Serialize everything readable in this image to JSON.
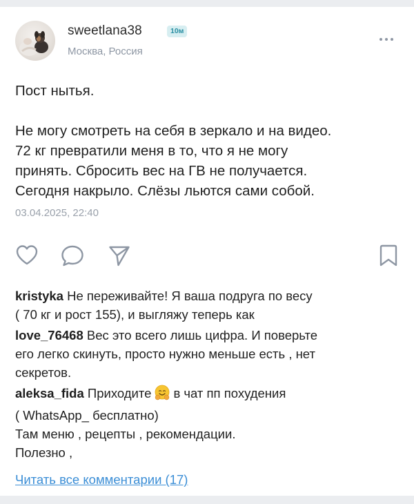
{
  "post": {
    "username": "sweetlana38",
    "badge": "10м",
    "location": "Москва, Россия",
    "text_lines": [
      "Пост нытья.",
      "",
      "Не могу смотреть на себя в зеркало и на видео.",
      "72 кг превратили меня в то, что я не могу",
      "принять. Сбросить вес на ГВ не получается.",
      "Сегодня накрыло. Слёзы льются сами собой."
    ],
    "date": "03.04.2025, 22:40"
  },
  "actions": {
    "like_icon": "heart-icon",
    "comment_icon": "comment-bubble-icon",
    "share_icon": "send-icon",
    "bookmark_icon": "bookmark-icon",
    "more_icon": "more-dots-icon"
  },
  "comments": [
    {
      "author": "kristyka",
      "lines": [
        " Не переживайте! Я ваша подруга по весу",
        "( 70 кг и рост 155), и выгляжу теперь как"
      ]
    },
    {
      "author": "love_76468",
      "lines": [
        " Вес это всего лишь цифра. И поверьте",
        "его легко скинуть, просто нужно меньше есть , нет",
        "секретов."
      ]
    },
    {
      "author": "aleksa_fida",
      "line1_before_emoji": " Приходите",
      "emoji": "hugging-face-emoji",
      "line1_after_emoji": "в чат пп похудения",
      "lines": [
        "( WhatsApp_ бесплатно)",
        "Там меню , рецепты , рекомендации.",
        "Полезно ,"
      ]
    }
  ],
  "read_all_comments": "Читать все комментарии (17)",
  "colors": {
    "background": "#ebedf0",
    "card": "#ffffff",
    "badge_bg": "#d7eef1",
    "badge_text": "#2a8fa3",
    "link": "#3b8ed6",
    "muted": "#9aa1ab",
    "icon": "#8d96a3"
  }
}
